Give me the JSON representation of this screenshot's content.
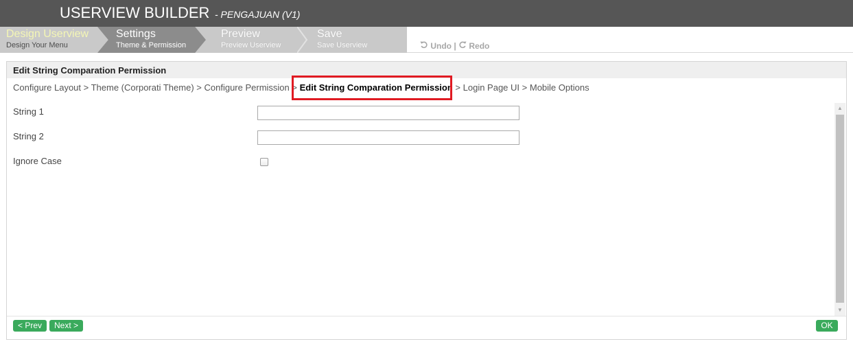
{
  "header": {
    "title": "USERVIEW BUILDER",
    "subtitle": "- PENGAJUAN (V1)"
  },
  "steps": [
    {
      "title": "Design Userview",
      "subtitle": "Design Your Menu",
      "state": "done"
    },
    {
      "title": "Settings",
      "subtitle": "Theme & Permission",
      "state": "active"
    },
    {
      "title": "Preview",
      "subtitle": "Preview Userview",
      "state": "todo"
    },
    {
      "title": "Save",
      "subtitle": "Save Userview",
      "state": "todo"
    }
  ],
  "toolbar": {
    "undo_label": "Undo",
    "separator": "|",
    "redo_label": "Redo"
  },
  "panel": {
    "title": "Edit String Comparation Permission",
    "breadcrumb": [
      {
        "label": "Configure Layout",
        "sep": " > "
      },
      {
        "label": "Theme (Corporati Theme)",
        "sep": " > "
      },
      {
        "label": "Configure Permission",
        "sep": " > "
      },
      {
        "label": "Edit String Comparation Permission",
        "sep": " > ",
        "current": true
      },
      {
        "label": "Login Page UI",
        "sep": " > "
      },
      {
        "label": "Mobile Options",
        "sep": ""
      }
    ],
    "fields": {
      "string1_label": "String 1",
      "string1_value": "",
      "string2_label": "String 2",
      "string2_value": "",
      "ignore_case_label": "Ignore Case",
      "ignore_case_checked": false
    },
    "buttons": {
      "prev": "< Prev",
      "next": "Next >",
      "ok": "OK"
    }
  },
  "colors": {
    "header_bg": "#565656",
    "button_green": "#3aaa5c",
    "highlight_red": "#e01a22"
  }
}
